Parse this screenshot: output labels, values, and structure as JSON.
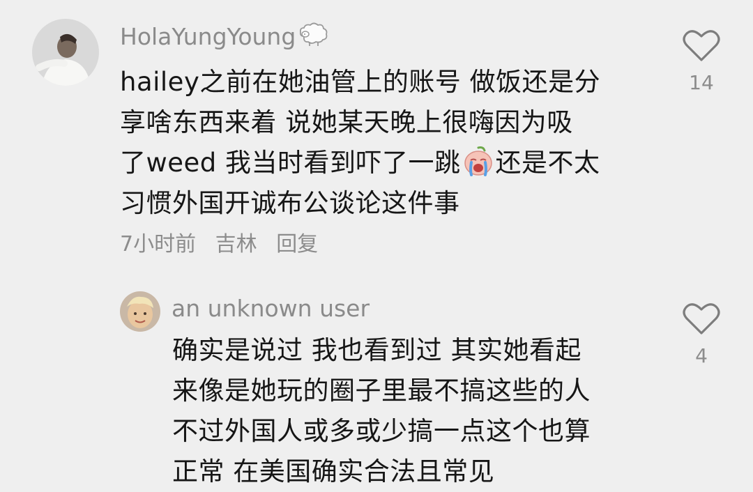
{
  "comments": [
    {
      "username": "HolaYungYoung",
      "username_badge_icon": "sheep-icon",
      "text_lines": [
        "hailey之前在她油管上的账号 做饭还是分",
        "享啥东西来着 说她某天晚上很嗨因为吸",
        "了weed 我当时看到吓了一跳",
        "还是不太",
        "习惯外国开诚布公谈论这件事"
      ],
      "inline_emoji_icon": "crying-face-emoji-icon",
      "time": "7小时前",
      "location": "吉林",
      "reply_label": "回复",
      "like_count": "14"
    },
    {
      "username": "an unknown user",
      "text_lines": [
        "确实是说过 我也看到过 其实她看起",
        "来像是她玩的圈子里最不搞这些的人",
        "不过外国人或多或少搞一点这个也算",
        "正常 在美国确实合法且常见"
      ],
      "like_count": "4"
    }
  ],
  "colors": {
    "background": "#efefef",
    "username": "#8a8a8a",
    "body_text": "#161616",
    "meta_text": "#8c8c8c",
    "heart_outline": "#7d7d7d"
  }
}
